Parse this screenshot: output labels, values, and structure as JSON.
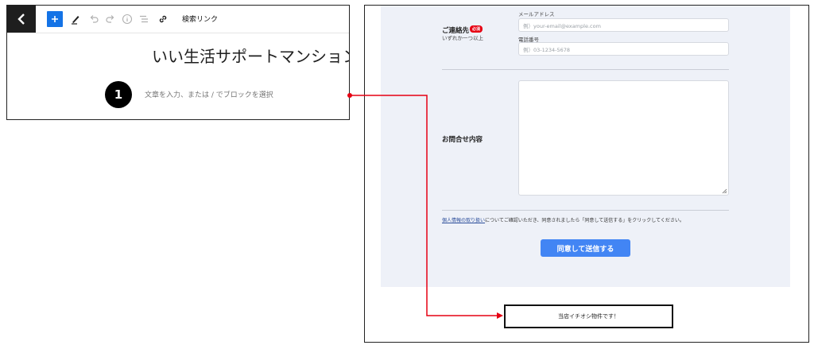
{
  "editor": {
    "toolbar": {
      "back_icon": "chevron-left-icon",
      "add_icon": "plus-icon",
      "tools_icon": "pen-icon",
      "undo_icon": "undo-icon",
      "redo_icon": "redo-icon",
      "info_icon": "info-icon",
      "outline_icon": "list-view-icon",
      "link_icon": "link-icon",
      "link_label": "検索リンク"
    },
    "post_title": "いい生活サポートマンション",
    "block_placeholder": "文章を入力、または / でブロックを選択"
  },
  "annotation": {
    "step_number": "1",
    "arrow_color": "#e60012"
  },
  "preview": {
    "contact": {
      "label": "ご連絡先",
      "required_badge": "必須",
      "sub_label": "いずれか一つ以上",
      "email_label": "メールアドレス",
      "email_placeholder": "例）your-email@example.com",
      "phone_label": "電話番号",
      "phone_placeholder": "例）03-1234-5678"
    },
    "inquiry": {
      "label": "お問合せ内容"
    },
    "privacy": {
      "link_text": "個人情報の取り扱い",
      "text": "についてご確認いただき、同意されましたら「同意して送信する」をクリックしてください。"
    },
    "submit_label": "同意して送信する",
    "featured_text": "当店イチオシ物件です！"
  },
  "colors": {
    "accent_blue": "#1473e6",
    "submit_blue": "#4285f4",
    "required_red": "#e60012",
    "form_bg": "#eef1f8"
  }
}
